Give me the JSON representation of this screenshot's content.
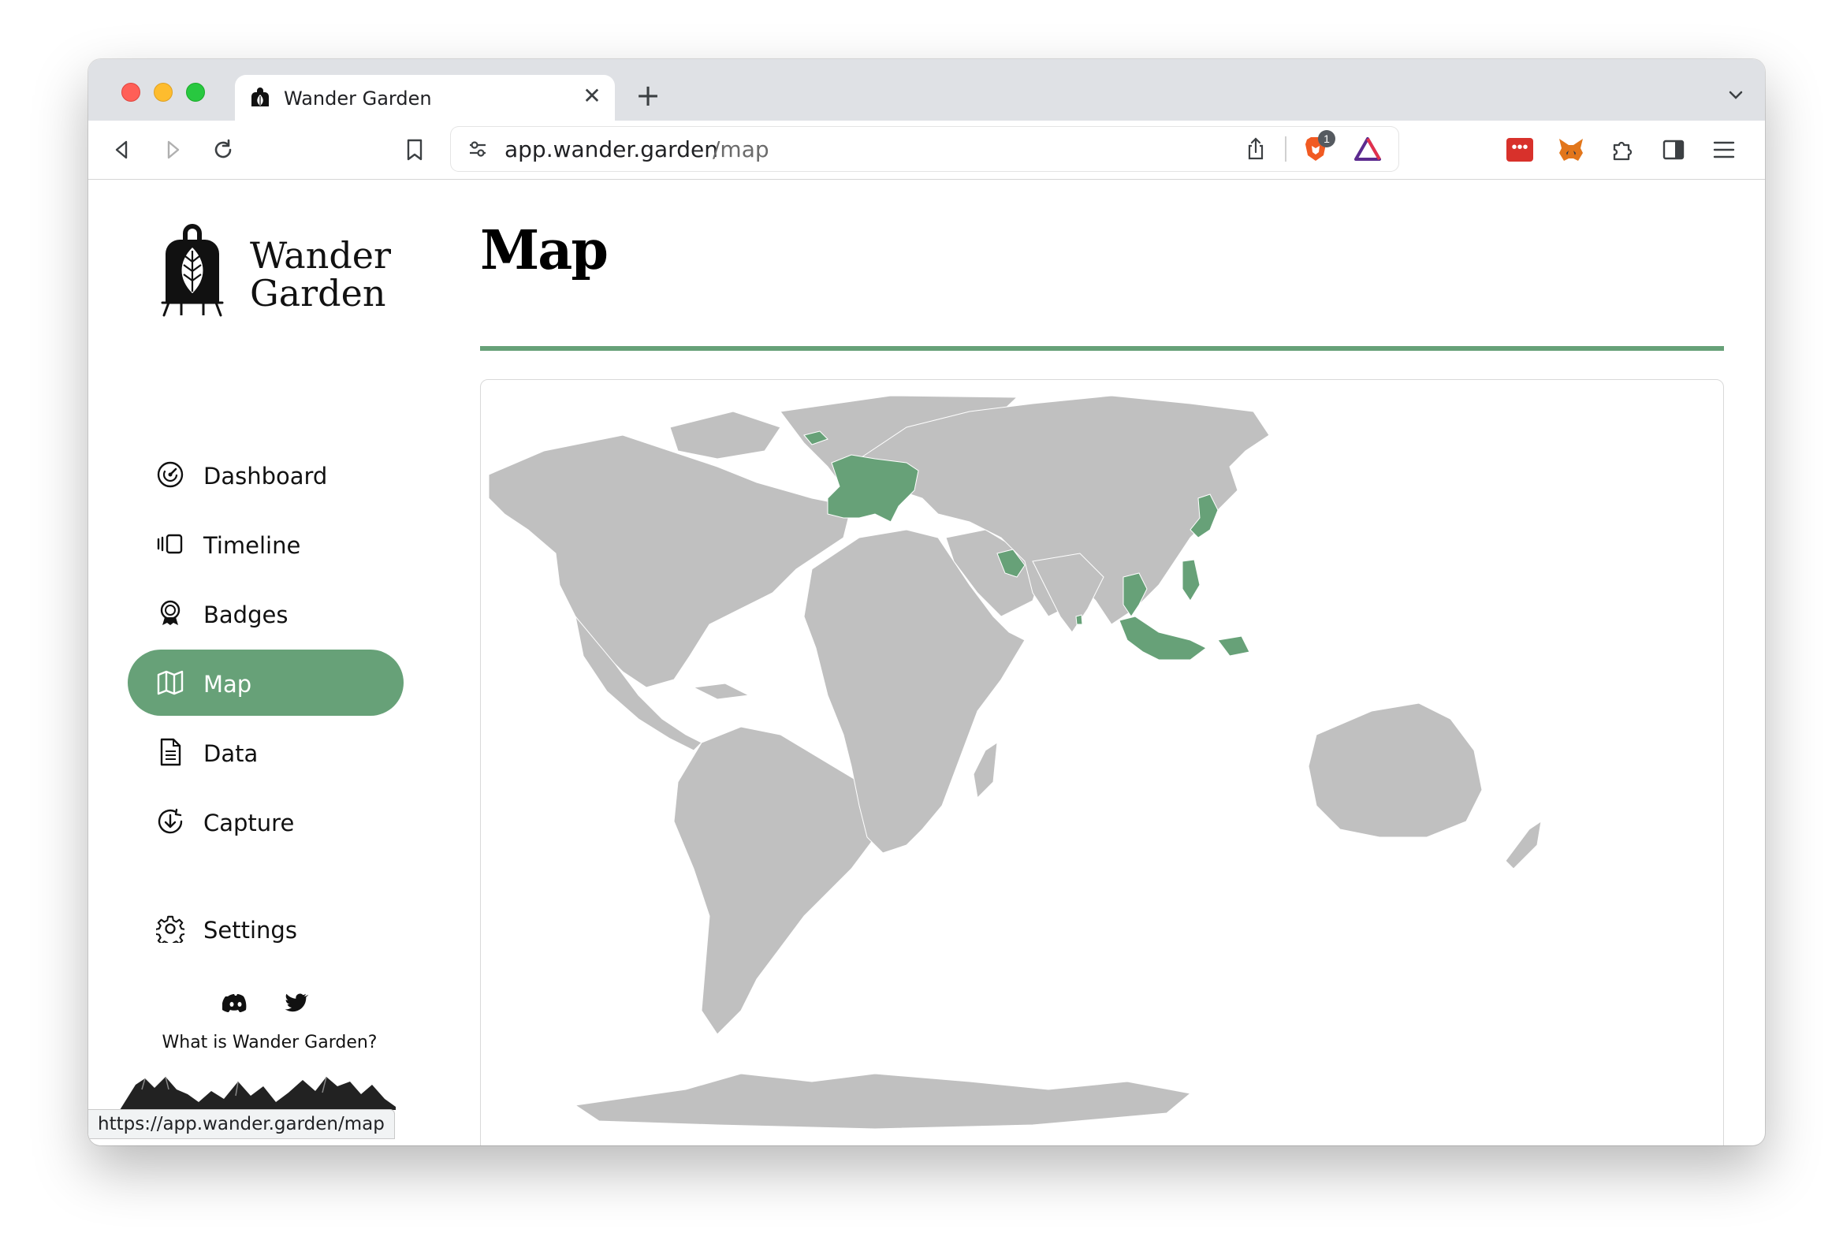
{
  "browser": {
    "tab_title": "Wander Garden",
    "url_host": "app.wander.garden",
    "url_path": "/map",
    "brave_badge_count": "1",
    "status_url": "https://app.wander.garden/map"
  },
  "app": {
    "logo_line1": "Wander",
    "logo_line2": "Garden",
    "nav": [
      {
        "label": "Dashboard",
        "icon": "gauge-icon",
        "active": false
      },
      {
        "label": "Timeline",
        "icon": "timeline-icon",
        "active": false
      },
      {
        "label": "Badges",
        "icon": "badge-icon",
        "active": false
      },
      {
        "label": "Map",
        "icon": "map-icon",
        "active": true
      },
      {
        "label": "Data",
        "icon": "document-icon",
        "active": false
      },
      {
        "label": "Capture",
        "icon": "capture-icon",
        "active": false
      }
    ],
    "settings_label": "Settings",
    "footer_link": "What is Wander Garden?",
    "social": [
      "discord-icon",
      "twitter-icon"
    ]
  },
  "main": {
    "title": "Map",
    "accent_color": "#67a178",
    "land_color": "#c0c0c0",
    "visited_regions": [
      "Iceland",
      "Europe",
      "Oman",
      "Sri Lanka",
      "Japan",
      "Thailand",
      "Cambodia",
      "Malaysia",
      "Indonesia",
      "Philippines",
      "Papua"
    ]
  }
}
